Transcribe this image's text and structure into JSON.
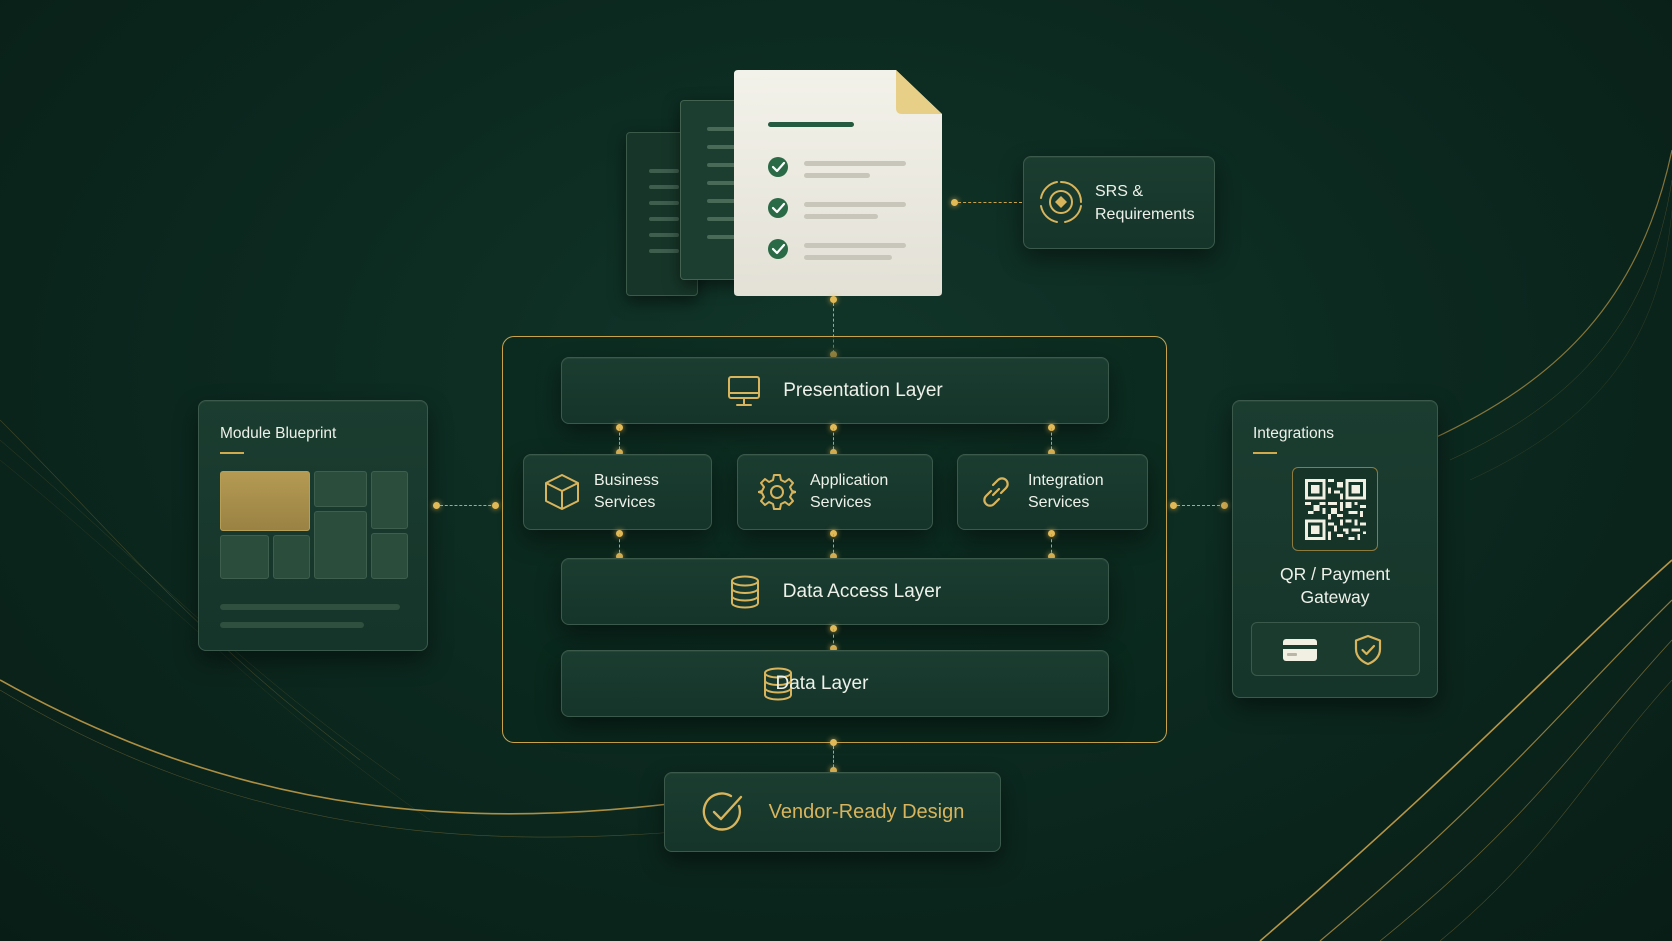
{
  "document": {
    "checklist_items": 3
  },
  "srs": {
    "line1": "SRS &",
    "line2": "Requirements"
  },
  "architecture": {
    "presentation": "Presentation Layer",
    "services": [
      {
        "line1": "Business",
        "line2": "Services",
        "icon": "cube-icon"
      },
      {
        "line1": "Application",
        "line2": "Services",
        "icon": "gear-icon"
      },
      {
        "line1": "Integration",
        "line2": "Services",
        "icon": "link-icon"
      }
    ],
    "data_access": "Data Access Layer",
    "data": "Data Layer"
  },
  "module_blueprint": {
    "title": "Module Blueprint"
  },
  "integrations": {
    "title": "Integrations",
    "qr_line1": "QR / Payment",
    "qr_line2": "Gateway",
    "icons": [
      "credit-card-icon",
      "shield-check-icon"
    ]
  },
  "vendor": {
    "label": "Vendor-Ready Design"
  },
  "colors": {
    "background": "#0c2a20",
    "panel": "#1b3d30",
    "gold": "#d8b45c",
    "document": "#efeee6"
  }
}
